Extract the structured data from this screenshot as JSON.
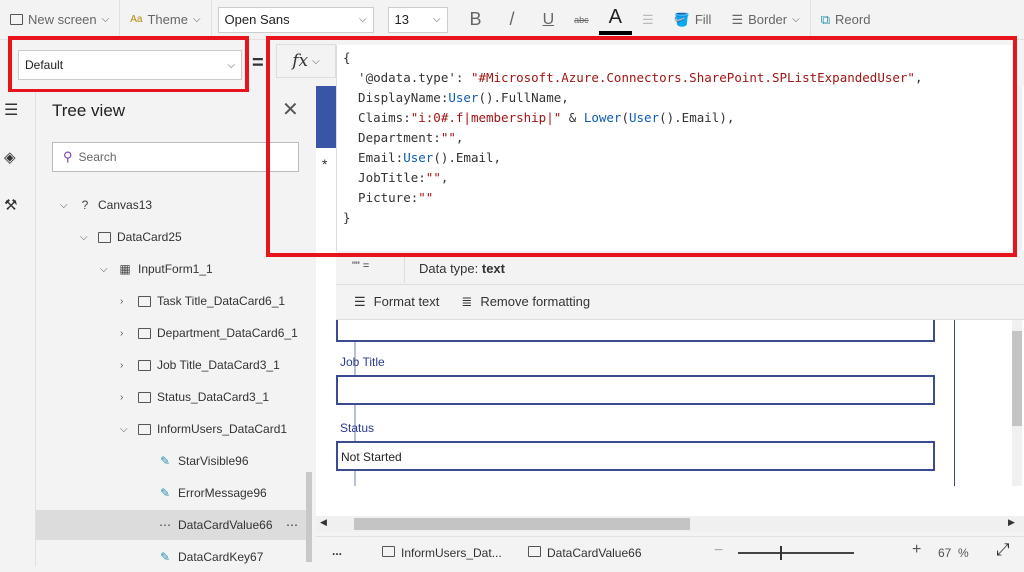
{
  "toolbar": {
    "new_screen": "New screen",
    "theme": "Theme",
    "font": "Open Sans",
    "font_size": "13",
    "bold": "B",
    "italic": "/",
    "underline": "U",
    "strike": "abc",
    "font_color": "A",
    "fill": "Fill",
    "border": "Border",
    "reorder": "Reord"
  },
  "property_selector": {
    "value": "Default"
  },
  "formula": {
    "equals": "=",
    "fx": "fx",
    "lines": [
      [
        {
          "t": "{",
          "c": ""
        }
      ],
      [
        {
          "t": "  '@odata.type': ",
          "c": ""
        },
        {
          "t": "\"#Microsoft.Azure.Connectors.SharePoint.SPListExpandedUser\"",
          "c": "str"
        },
        {
          "t": ",",
          "c": ""
        }
      ],
      [
        {
          "t": "  DisplayName:",
          "c": ""
        },
        {
          "t": "User",
          "c": "fn"
        },
        {
          "t": "().FullName,",
          "c": ""
        }
      ],
      [
        {
          "t": "  Claims:",
          "c": ""
        },
        {
          "t": "\"i:0#.f|membership|\"",
          "c": "str"
        },
        {
          "t": " & ",
          "c": ""
        },
        {
          "t": "Lower",
          "c": "fn"
        },
        {
          "t": "(",
          "c": ""
        },
        {
          "t": "User",
          "c": "fn"
        },
        {
          "t": "().Email),",
          "c": ""
        }
      ],
      [
        {
          "t": "  Department:",
          "c": ""
        },
        {
          "t": "\"\"",
          "c": "str"
        },
        {
          "t": ",",
          "c": ""
        }
      ],
      [
        {
          "t": "  Email:",
          "c": ""
        },
        {
          "t": "User",
          "c": "fn"
        },
        {
          "t": "().Email,",
          "c": ""
        }
      ],
      [
        {
          "t": "  JobTitle:",
          "c": ""
        },
        {
          "t": "\"\"",
          "c": "str"
        },
        {
          "t": ",",
          "c": ""
        }
      ],
      [
        {
          "t": "  Picture:",
          "c": ""
        },
        {
          "t": "\"\"",
          "c": "str"
        }
      ],
      [
        {
          "t": "}",
          "c": ""
        }
      ]
    ],
    "result_preview": "\"\"  =",
    "data_type_label": "Data type: ",
    "data_type_value": "text",
    "format_text": "Format text",
    "remove_formatting": "Remove formatting"
  },
  "tree": {
    "title": "Tree view",
    "search_placeholder": "Search",
    "items": [
      {
        "label": "Canvas13",
        "level": 0,
        "icon": "help-icon",
        "expanded": true
      },
      {
        "label": "DataCard25",
        "level": 1,
        "icon": "card-icon",
        "expanded": true
      },
      {
        "label": "InputForm1_1",
        "level": 2,
        "icon": "form-icon",
        "expanded": true
      },
      {
        "label": "Task Title_DataCard6_1",
        "level": 3,
        "icon": "card-icon",
        "expanded": false
      },
      {
        "label": "Department_DataCard6_1",
        "level": 3,
        "icon": "card-icon",
        "expanded": false
      },
      {
        "label": "Job Title_DataCard3_1",
        "level": 3,
        "icon": "card-icon",
        "expanded": false
      },
      {
        "label": "Status_DataCard3_1",
        "level": 3,
        "icon": "card-icon",
        "expanded": false
      },
      {
        "label": "InformUsers_DataCard1",
        "level": 3,
        "icon": "card-icon",
        "expanded": true
      },
      {
        "label": "StarVisible96",
        "level": 4,
        "icon": "edit-icon"
      },
      {
        "label": "ErrorMessage96",
        "level": 4,
        "icon": "edit-icon"
      },
      {
        "label": "DataCardValue66",
        "level": 4,
        "icon": "textinput-icon",
        "selected": true
      },
      {
        "label": "DataCardKey67",
        "level": 4,
        "icon": "edit-icon"
      }
    ]
  },
  "form": {
    "job_title_label": "Job Title",
    "status_label": "Status",
    "status_value": "Not Started",
    "asterisk": "*"
  },
  "statusbar": {
    "more": "...",
    "crumb1": "InformUsers_Dat...",
    "crumb2": "DataCardValue66",
    "zoom": "67",
    "zoom_unit": "%",
    "zoom_fraction": 0.36
  }
}
